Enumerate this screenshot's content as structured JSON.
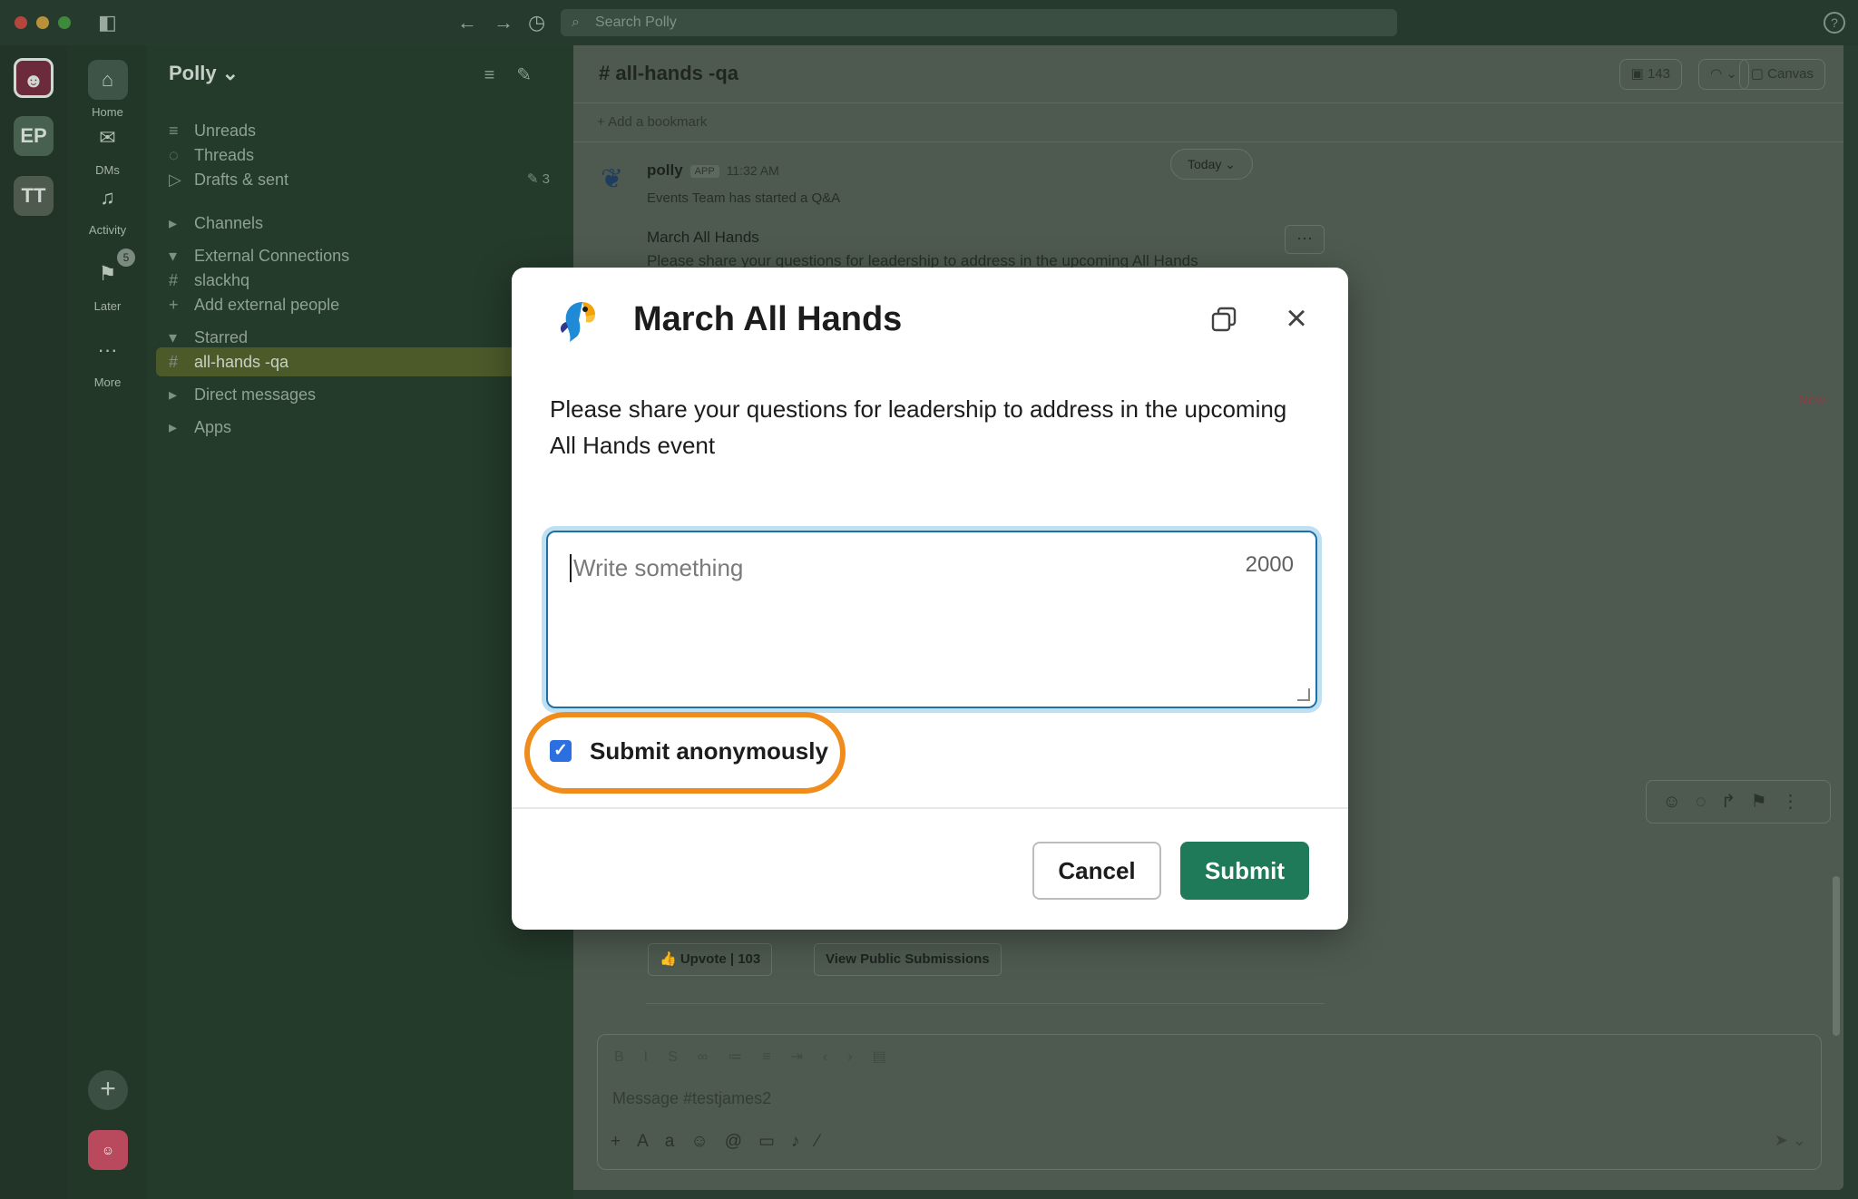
{
  "titlebar": {
    "search_placeholder": "Search Polly",
    "help_icon": "?"
  },
  "workspaces": [
    {
      "label": "EP"
    },
    {
      "label": "TT"
    }
  ],
  "nav": {
    "home": "Home",
    "dms": "DMs",
    "activity": "Activity",
    "later": "Later",
    "later_badge": "5",
    "more": "More"
  },
  "sidebar": {
    "workspace_name": "Polly ⌄",
    "items": [
      {
        "icon": "≡",
        "label": "Unreads"
      },
      {
        "icon": "◌",
        "label": "Threads"
      },
      {
        "icon": "▷",
        "label": "Drafts & sent",
        "tail": "✎ 3"
      }
    ],
    "sections": {
      "channels": "Channels",
      "external": "External Connections",
      "slackhq": "slackhq",
      "add_external": "Add external people",
      "starred": "Starred",
      "active_channel": "all-hands -qa",
      "direct_messages": "Direct messages",
      "apps": "Apps"
    }
  },
  "channel": {
    "title": "# all-hands -qa",
    "member_count": "143",
    "canvas": "Canvas",
    "add_bookmark": "+   Add a bookmark",
    "today": "Today ⌄",
    "message": {
      "author": "polly",
      "app_tag": "APP",
      "time": "11:32 AM",
      "subtitle": "Events Team has started a Q&A",
      "title": "March All Hands",
      "prompt": "Please share your questions for leadership to address in the upcoming All Hands"
    },
    "new_label": "New",
    "upvote": "👍 Upvote | 103",
    "view_public": "View Public Submissions",
    "composer_placeholder": "Message #testjames2"
  },
  "modal": {
    "title": "March All Hands",
    "description": "Please share your questions for leadership to address in the upcoming All Hands event",
    "textarea_placeholder": "Write something",
    "char_limit": "2000",
    "checkbox_label": "Submit anonymously",
    "checkbox_checked": true,
    "cancel_label": "Cancel",
    "submit_label": "Submit"
  },
  "colors": {
    "submit_green": "#1f7a5a",
    "highlight_orange": "#f08c1c",
    "checkbox_blue": "#2c6fe0"
  }
}
